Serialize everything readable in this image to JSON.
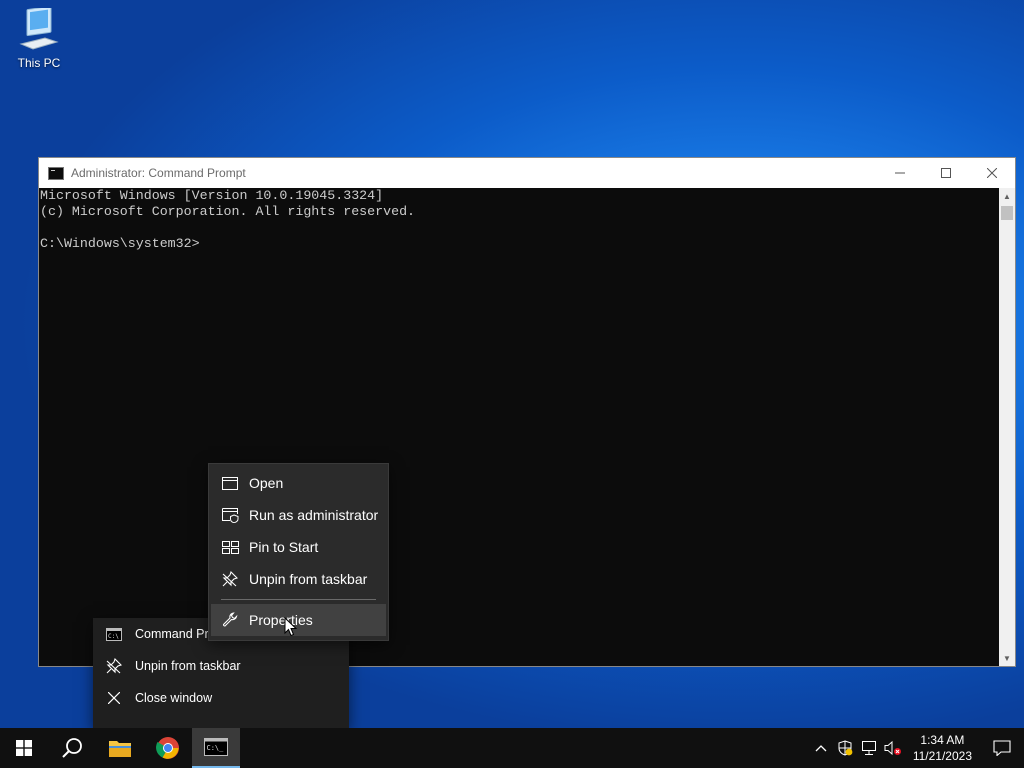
{
  "desktop": {
    "this_pc_label": "This PC"
  },
  "window": {
    "title": "Administrator: Command Prompt",
    "console_lines": [
      "Microsoft Windows [Version 10.0.19045.3324]",
      "(c) Microsoft Corporation. All rights reserved.",
      "",
      "C:\\Windows\\system32>"
    ]
  },
  "context_menu": {
    "items": [
      {
        "label": "Open",
        "icon": "window-icon"
      },
      {
        "label": "Run as administrator",
        "icon": "shield-window-icon"
      },
      {
        "label": "Pin to Start",
        "icon": "pin-to-start-icon"
      },
      {
        "label": "Unpin from taskbar",
        "icon": "unpin-icon"
      },
      {
        "label": "Properties",
        "icon": "wrench-icon"
      }
    ]
  },
  "jump_list": {
    "items": [
      {
        "label": "Command Prompt",
        "icon": "cmd-icon"
      },
      {
        "label": "Unpin from taskbar",
        "icon": "unpin-icon"
      },
      {
        "label": "Close window",
        "icon": "close-icon"
      }
    ]
  },
  "taskbar": {
    "clock_time": "1:34 AM",
    "clock_date": "11/21/2023"
  },
  "colors": {
    "desktop": "#0c5cc9",
    "taskbar": "#101010",
    "menu": "#2b2b2b",
    "accent": "#76b9ed"
  }
}
